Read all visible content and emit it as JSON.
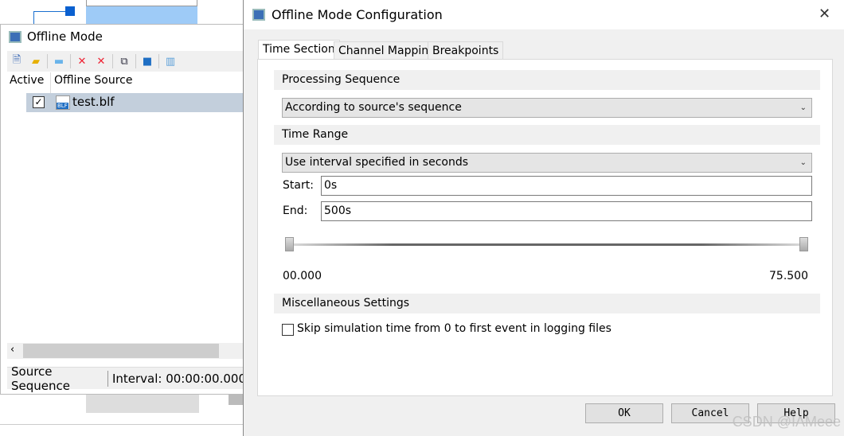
{
  "offline_panel": {
    "title": "Offline Mode",
    "toolbar": [
      "add-file-icon",
      "add-folder-icon",
      "folder-new-icon",
      "remove-file-icon",
      "remove-all-icon",
      "copy-icon",
      "folder-icon",
      "columns-icon"
    ],
    "columns": [
      "Active",
      "Offline Source"
    ],
    "rows": [
      {
        "active": true,
        "source": "test.blf",
        "icon_text": "BLF"
      }
    ],
    "status": {
      "sequence": "Source Sequence",
      "interval": "Interval: 00:00:00.000"
    }
  },
  "dialog": {
    "title": "Offline Mode Configuration",
    "tabs": [
      "Time Section",
      "Channel Mapping",
      "Breakpoints"
    ],
    "processing": {
      "header": "Processing Sequence",
      "value": "According to source's sequence"
    },
    "time_range": {
      "header": "Time Range",
      "mode": "Use interval specified in seconds",
      "start_label": "Start:",
      "start": "0s",
      "end_label": "End:",
      "end": "500s",
      "slider_min": "00.000",
      "slider_max": "75.500",
      "slider_range": [
        0,
        1
      ]
    },
    "misc": {
      "header": "Miscellaneous Settings",
      "skip_label": "Skip simulation time from 0 to first event in logging files",
      "skip_checked": false
    },
    "buttons": {
      "ok": "OK",
      "cancel": "Cancel",
      "help": "Help"
    }
  },
  "watermark": "CSDN @IAMeee"
}
